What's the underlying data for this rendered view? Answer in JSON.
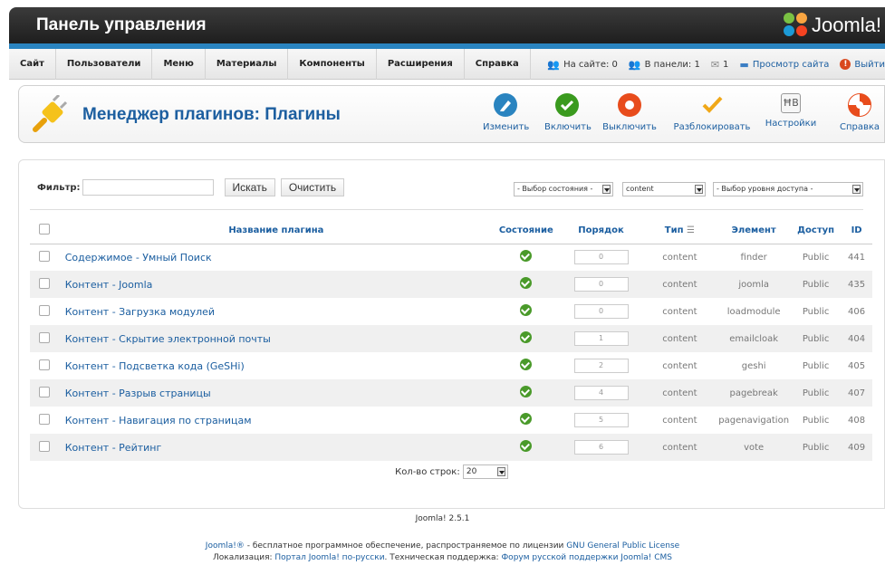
{
  "header": {
    "title": "Панель управления",
    "logo_text": "Joomla!"
  },
  "menu": {
    "items": [
      "Сайт",
      "Пользователи",
      "Меню",
      "Материалы",
      "Компоненты",
      "Расширения",
      "Справка"
    ]
  },
  "status": {
    "on_site": "На сайте: 0",
    "in_panel": "В панели: 1",
    "messages": "1",
    "view_site": "Просмотр сайта",
    "logout": "Выйти"
  },
  "toolbar": {
    "page_title": "Менеджер плагинов: Плагины",
    "edit_label": "Изменить",
    "enable_label": "Включить",
    "disable_label": "Выключить",
    "unlock_label": "Разблокировать",
    "options_label": "Настройки",
    "help_label": "Справка"
  },
  "filter": {
    "label": "Фильтр:",
    "value": "",
    "search_button": "Искать",
    "clear_button": "Очистить",
    "state_select": "- Выбор состояния -",
    "type_select": "content",
    "access_select": "- Выбор уровня доступа -"
  },
  "table": {
    "headers": {
      "name": "Название плагина",
      "state": "Состояние",
      "order": "Порядок",
      "type": "Тип",
      "element": "Элемент",
      "access": "Доступ",
      "id": "ID"
    },
    "rows": [
      {
        "name": "Содержимое - Умный Поиск",
        "order": "0",
        "type": "content",
        "element": "finder",
        "access": "Public",
        "id": "441"
      },
      {
        "name": "Контент - Joomla",
        "order": "0",
        "type": "content",
        "element": "joomla",
        "access": "Public",
        "id": "435"
      },
      {
        "name": "Контент - Загрузка модулей",
        "order": "0",
        "type": "content",
        "element": "loadmodule",
        "access": "Public",
        "id": "406"
      },
      {
        "name": "Контент - Скрытие электронной почты",
        "order": "1",
        "type": "content",
        "element": "emailcloak",
        "access": "Public",
        "id": "404"
      },
      {
        "name": "Контент - Подсветка кода (GeSHi)",
        "order": "2",
        "type": "content",
        "element": "geshi",
        "access": "Public",
        "id": "405"
      },
      {
        "name": "Контент - Разрыв страницы",
        "order": "4",
        "type": "content",
        "element": "pagebreak",
        "access": "Public",
        "id": "407"
      },
      {
        "name": "Контент - Навигация по страницам",
        "order": "5",
        "type": "content",
        "element": "pagenavigation",
        "access": "Public",
        "id": "408"
      },
      {
        "name": "Контент - Рейтинг",
        "order": "6",
        "type": "content",
        "element": "vote",
        "access": "Public",
        "id": "409"
      }
    ]
  },
  "pager": {
    "label": "Кол-во строк:",
    "value": "20"
  },
  "footer": {
    "version": "Joomla! 2.5.1",
    "line1_brand": "Joomla!®",
    "line1_text": " - бесплатное программное обеспечение, распространяемое по лицензии ",
    "line1_license": "GNU General Public License",
    "line2_prefix": "Локализация: ",
    "line2_portal": "Портал Joomla! по-русски",
    "line2_mid": ". Техническая поддержка: ",
    "line2_forum": "Форум русской поддержки Joomla! CMS"
  },
  "colors": {
    "link": "#1b5ea0",
    "header": "#2b2b2b",
    "accent": "#2a84c0",
    "enabled": "#4a9a2a"
  }
}
